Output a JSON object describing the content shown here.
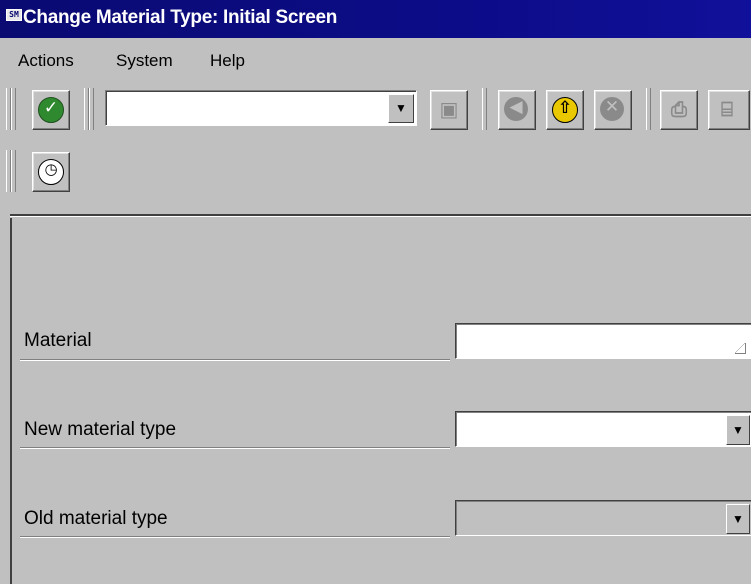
{
  "window": {
    "title": "Change Material Type: Initial Screen",
    "sys_icon_text": "SM"
  },
  "menu": {
    "actions": "Actions",
    "system": "System",
    "help": "Help"
  },
  "toolbar": {
    "command_field_value": "",
    "buttons": [
      {
        "name": "enter",
        "icon": "check-icon",
        "enabled": true
      },
      {
        "name": "save",
        "icon": "save-icon",
        "enabled": false
      },
      {
        "name": "back",
        "icon": "back-icon",
        "enabled": false
      },
      {
        "name": "exit",
        "icon": "exit-icon",
        "enabled": true
      },
      {
        "name": "cancel",
        "icon": "cancel-icon",
        "enabled": false
      },
      {
        "name": "print",
        "icon": "print-icon",
        "enabled": false
      },
      {
        "name": "find",
        "icon": "find-icon",
        "enabled": false
      }
    ]
  },
  "app_toolbar": {
    "buttons": [
      {
        "name": "execute",
        "icon": "clock-icon",
        "enabled": true
      }
    ]
  },
  "form": {
    "material_label": "Material",
    "material_value": "",
    "new_type_label": "New material type",
    "new_type_value": "",
    "old_type_label": "Old material type",
    "old_type_value": ""
  },
  "colors": {
    "title_bar": "#0a0a72",
    "background": "#c0c0c0",
    "check_green": "#2f8a2f",
    "exit_yellow": "#e9c800"
  }
}
